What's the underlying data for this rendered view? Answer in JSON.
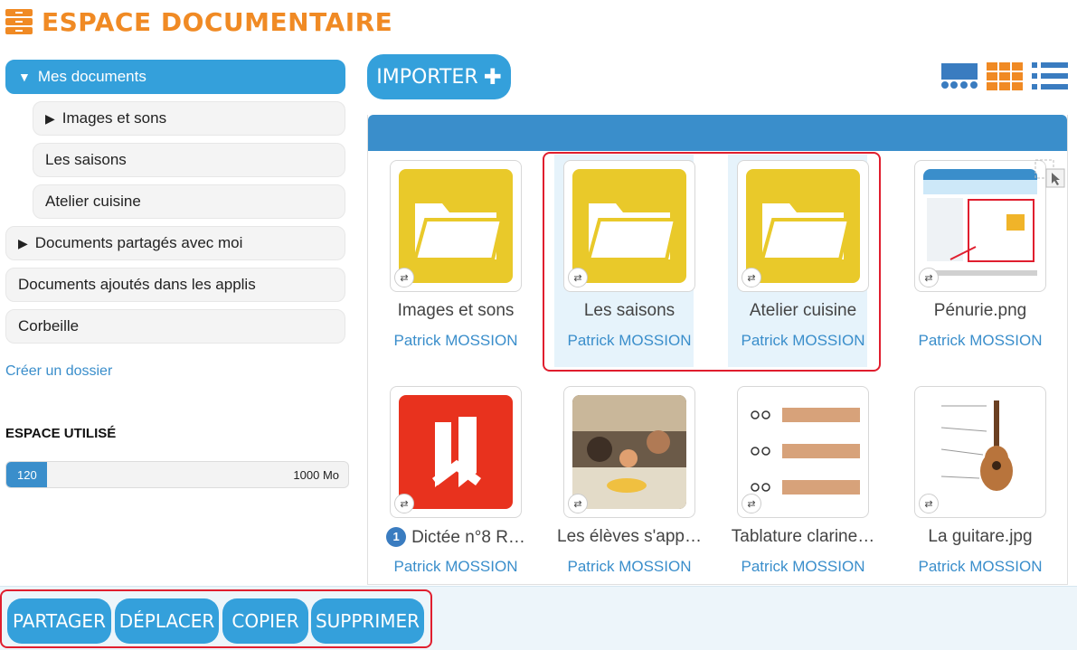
{
  "header": {
    "title": "ESPACE DOCUMENTAIRE",
    "icon": "drawer-icon",
    "accent": "#f08a24"
  },
  "sidebar": {
    "items": [
      {
        "label": "Mes documents",
        "expanded": true,
        "active": true
      },
      {
        "label": "Images et sons",
        "collapsed": true
      },
      {
        "label": "Les saisons"
      },
      {
        "label": "Atelier cuisine"
      },
      {
        "label": "Documents partagés avec moi",
        "collapsed": true
      },
      {
        "label": "Documents ajoutés dans les applis"
      },
      {
        "label": "Corbeille"
      }
    ],
    "create_folder": "Créer un dossier",
    "usage": {
      "title": "ESPACE UTILISÉ",
      "used": "120",
      "total": "1000 Mo",
      "fill_fraction": 0.12
    }
  },
  "toolbar": {
    "import_label": "IMPORTER",
    "import_icon": "plus-icon",
    "views": [
      "carousel-view-icon",
      "grid-view-icon",
      "list-view-icon"
    ]
  },
  "files": [
    {
      "name": "Images et sons",
      "owner": "Patrick MOSSION",
      "type": "folder",
      "selected": false
    },
    {
      "name": "Les saisons",
      "owner": "Patrick MOSSION",
      "type": "folder",
      "selected": true
    },
    {
      "name": "Atelier cuisine",
      "owner": "Patrick MOSSION",
      "type": "folder",
      "selected": true
    },
    {
      "name": "Pénurie.png",
      "owner": "Patrick MOSSION",
      "type": "image",
      "selected": false
    },
    {
      "name": "Dictée n°8 R…",
      "owner": "Patrick MOSSION",
      "type": "app",
      "badge": "1",
      "selected": false
    },
    {
      "name": "Les élèves s'app…",
      "owner": "Patrick MOSSION",
      "type": "photo",
      "selected": false
    },
    {
      "name": "Tablature clarine…",
      "owner": "Patrick MOSSION",
      "type": "image",
      "selected": false
    },
    {
      "name": "La guitare.jpg",
      "owner": "Patrick MOSSION",
      "type": "image",
      "selected": false
    }
  ],
  "actions": {
    "share": "PARTAGER",
    "move": "DÉPLACER",
    "copy": "COPIER",
    "delete": "SUPPRIMER"
  },
  "colors": {
    "primary": "#34a0db",
    "link": "#3a8ecb",
    "folder": "#e9c92a",
    "highlight": "#e01e2e"
  }
}
